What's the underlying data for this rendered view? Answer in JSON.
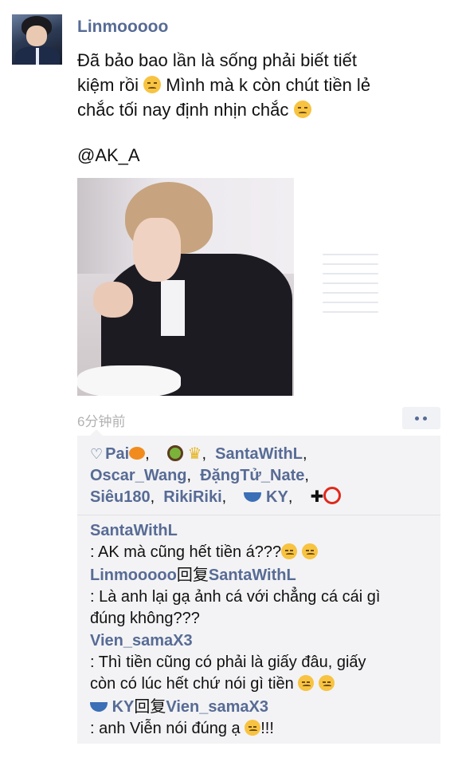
{
  "post": {
    "username": "Linmooooo",
    "text_lines": [
      "Đã bảo bao lần là sống phải biết tiết",
      "kiệm rồi",
      "Mình mà k còn chút tiền lẻ",
      "chắc tối nay định nhịn chắc"
    ],
    "mention": "@AK_A",
    "time": "6分钟前"
  },
  "likes": {
    "users": [
      "Pai",
      "SantaWithL",
      "Oscar_Wang",
      "ĐặngTử_Nate",
      "Siêu180",
      "RikiRiki",
      "KY"
    ],
    "separator": ",",
    "plus": "✚"
  },
  "comments": [
    {
      "name": "SantaWithL",
      "reply_word": "",
      "reply_to": "",
      "text": ": AK mà cũng hết tiền á???"
    },
    {
      "name": "Linmooooo",
      "reply_word": "回复",
      "reply_to": "SantaWithL",
      "text_lines": [
        ": Là anh lại gạ ảnh cá với chẳng cá cái gì",
        "đúng không???"
      ]
    },
    {
      "name": "Vien_samaX3",
      "reply_word": "",
      "reply_to": "",
      "text_lines": [
        ": Thì tiền cũng có phải là giấy đâu, giấy",
        "còn có lúc hết chứ nói gì tiền"
      ]
    },
    {
      "name": "KY",
      "reply_word": "回复",
      "reply_to": "Vien_samaX3",
      "text": ": anh Viễn nói đúng ạ",
      "suffix": "!!!"
    }
  ],
  "colors": {
    "link": "#576b95",
    "panel": "#f3f3f5",
    "time": "#b2b2b2"
  }
}
